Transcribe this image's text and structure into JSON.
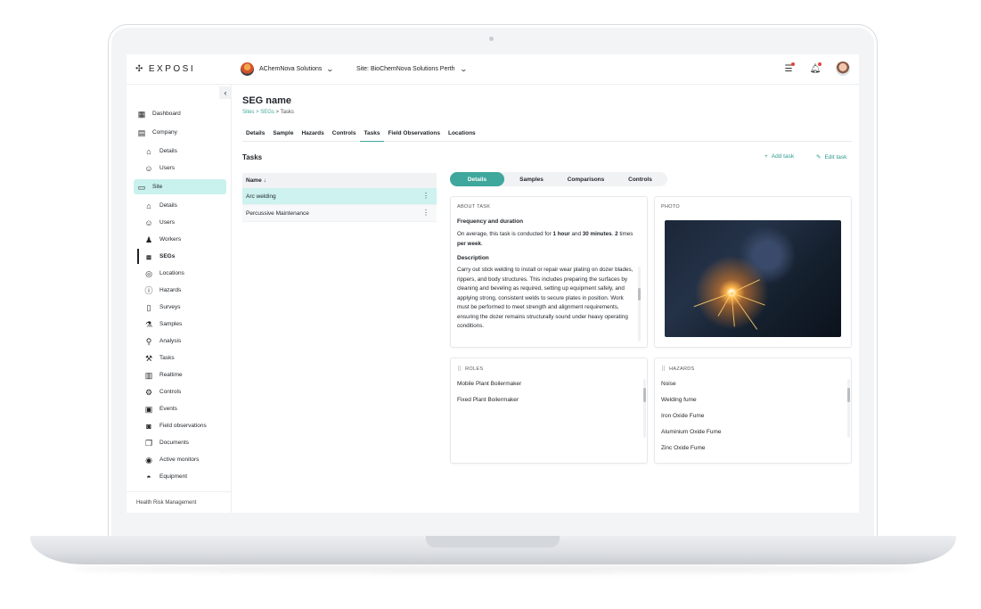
{
  "app": {
    "logo": "EXPOSI",
    "company": "AChemNova Solutions",
    "site_selector": "Site: BioChemNova Solutions Perth"
  },
  "sidebar": {
    "items": [
      {
        "label": "Dashboard",
        "icon": "dashboard-icon"
      },
      {
        "label": "Company",
        "icon": "building-icon"
      },
      {
        "label": "Details",
        "icon": "home-icon"
      },
      {
        "label": "Users",
        "icon": "user-icon"
      },
      {
        "label": "Site",
        "icon": "site-icon"
      },
      {
        "label": "Details",
        "icon": "home-icon"
      },
      {
        "label": "Users",
        "icon": "user-icon"
      },
      {
        "label": "Workers",
        "icon": "worker-icon"
      },
      {
        "label": "SEGs",
        "icon": "briefcase-icon"
      },
      {
        "label": "Locations",
        "icon": "location-icon"
      },
      {
        "label": "Hazards",
        "icon": "hazard-icon"
      },
      {
        "label": "Surveys",
        "icon": "clipboard-icon"
      },
      {
        "label": "Samples",
        "icon": "test-tube-icon"
      },
      {
        "label": "Analysis",
        "icon": "microscope-icon"
      },
      {
        "label": "Tasks",
        "icon": "hammer-icon"
      },
      {
        "label": "Realtime",
        "icon": "bar-chart-icon"
      },
      {
        "label": "Controls",
        "icon": "controls-icon"
      },
      {
        "label": "Events",
        "icon": "calendar-icon"
      },
      {
        "label": "Field observations",
        "icon": "camera-icon"
      },
      {
        "label": "Documents",
        "icon": "documents-icon"
      },
      {
        "label": "Active monitors",
        "icon": "monitor-icon"
      },
      {
        "label": "Equipment",
        "icon": "helmet-icon"
      }
    ],
    "footer": "Health Risk Management"
  },
  "page": {
    "title": "SEG name",
    "breadcrumb": {
      "a": "Sites",
      "sep1": " > ",
      "b": "SEGs",
      "sep2": " > ",
      "current": "Tasks"
    },
    "tabs": [
      "Details",
      "Sample",
      "Hazards",
      "Controls",
      "Tasks",
      "Field Observations",
      "Locations"
    ],
    "section_title": "Tasks",
    "add_task": "Add task",
    "edit_task": "Edit task"
  },
  "tasks_table": {
    "header": "Name",
    "sort_icon": "↓",
    "rows": [
      "Arc welding",
      "Percussive Maintenance"
    ]
  },
  "detail_tabs": [
    "Details",
    "Samples",
    "Comparisons",
    "Controls"
  ],
  "about": {
    "label": "ABOUT TASK",
    "freq_heading": "Frequency and duration",
    "freq_1": "On average, this task is conducted for ",
    "freq_hours": "1 hour",
    "freq_2": " and ",
    "freq_minutes": "30 minutes",
    "freq_3": ". ",
    "freq_times": "2",
    "freq_4": " times ",
    "freq_per": "per week",
    "freq_5": ".",
    "desc_heading": "Description",
    "desc": "Carry out stick welding to install or repair wear plating on dozer blades, rippers, and body structures. This includes preparing the surfaces by cleaning and beveling as required, setting up equipment safely, and applying strong, consistent welds to secure plates in position. Work must be performed to meet strength and alignment requirements, ensuring the dozer remains structurally sound under heavy operating conditions."
  },
  "photo": {
    "label": "PHOTO"
  },
  "roles": {
    "label": "ROLES",
    "items": [
      "Mobile Plant Boilermaker",
      "Fixed Plant Boilermaker"
    ]
  },
  "hazards": {
    "label": "HAZARDS",
    "items": [
      "Noise",
      "Welding fume",
      "Iron Oxide Fume",
      "Aluminium Oxide Fume",
      "Zinc Oxide Fume"
    ]
  },
  "colors": {
    "accent": "#3fa79c",
    "selected_bg": "#cdf2ef",
    "notification": "#e2453c"
  }
}
